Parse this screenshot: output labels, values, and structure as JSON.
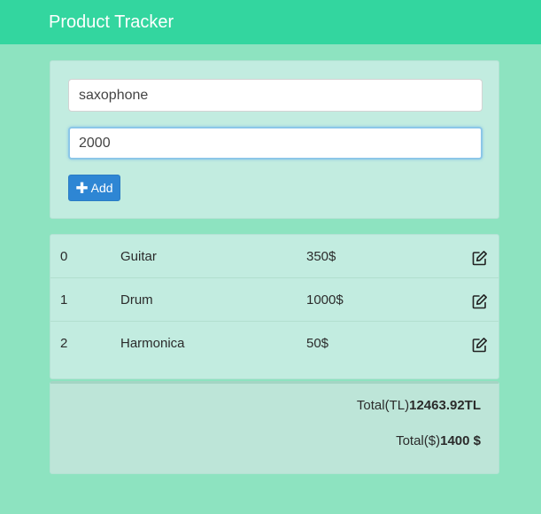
{
  "app": {
    "title": "Product Tracker"
  },
  "form": {
    "name_value": "saxophone",
    "price_value": "2000",
    "add_label": "Add"
  },
  "products": [
    {
      "index": "0",
      "name": "Guitar",
      "price": "350$"
    },
    {
      "index": "1",
      "name": "Drum",
      "price": "1000$"
    },
    {
      "index": "2",
      "name": "Harmonica",
      "price": "50$"
    }
  ],
  "totals": {
    "tl_label": "Total(TL)",
    "tl_value": "12463.92TL",
    "usd_label": "Total($)",
    "usd_value": "1400 $"
  },
  "icons": {
    "add": "plus-icon",
    "edit": "edit-icon"
  },
  "colors": {
    "navbar": "#33d69f",
    "background": "#8de3c0",
    "card": "#c2ece0",
    "button": "#2e86d4"
  }
}
